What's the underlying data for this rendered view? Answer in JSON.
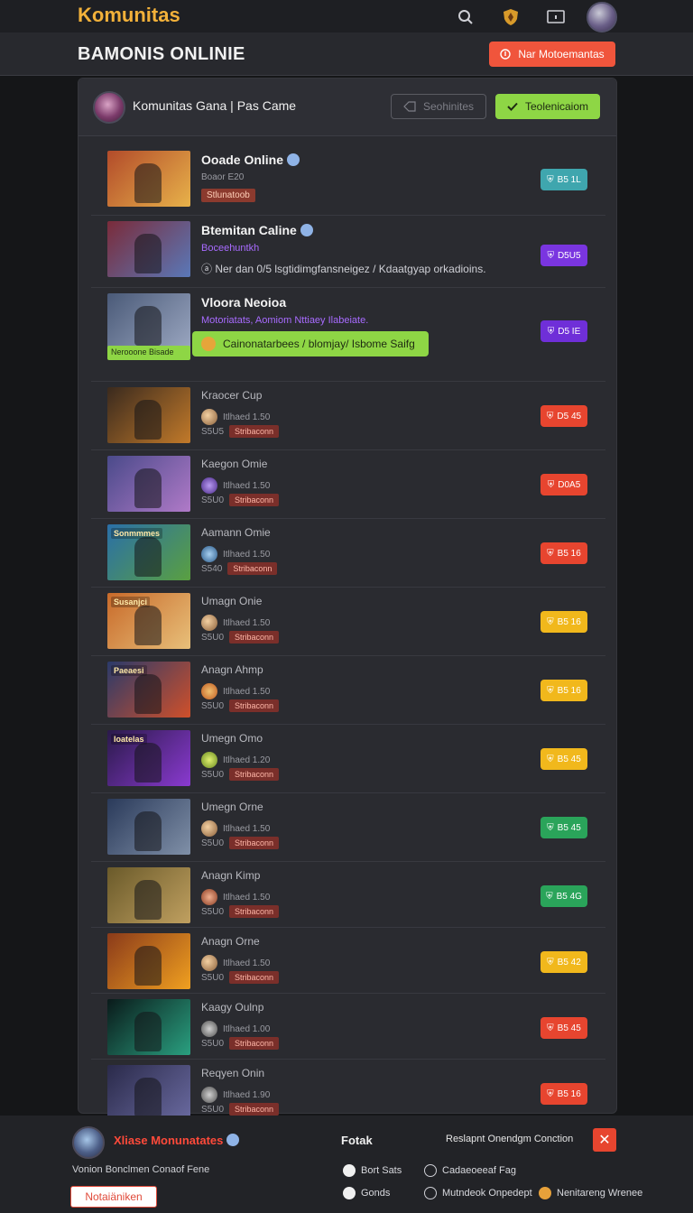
{
  "app": {
    "brand": "Komunitas"
  },
  "header": {
    "title": "BAMONIS ONLINIE",
    "cta_label": "Nar Motoemantas"
  },
  "panel": {
    "title": "Komunitas Gana | Pas Came",
    "outline_btn": "Seohinites",
    "green_btn": "Teolenicaiom"
  },
  "games": [
    {
      "title": "Ooade Online",
      "sub": "Boaor E20",
      "chip": "Stlunatoob",
      "badge": "B5 1L",
      "badge_color": "#3fa6ae",
      "thumb": [
        "#b24b2a",
        "#e8b24a"
      ]
    },
    {
      "title": "Btemitan Caline",
      "sub": "Boceehuntkh",
      "note": "Ner dan 0/5 lsgtidimgfansneigez / Kdaatgyap orkadioins.",
      "badge": "D5U5",
      "badge_color": "#7a35e0",
      "thumb": [
        "#7a2b3a",
        "#5a78b8"
      ]
    },
    {
      "title": "Vloora Neoioa",
      "sub": "Motoriatats, Aomiom Nttiaey Ilabeiate.",
      "promo": "Cainonatarbees / blomjay/ Isbome Saifg",
      "tag": "Nerooone Bisade",
      "badge": "D5 IE",
      "badge_color": "#6f2fd8",
      "thumb": [
        "#4a5a78",
        "#9aa6c0"
      ]
    },
    {
      "title": "Kraocer Cup",
      "meta": "Itlhaed 1.50",
      "num": "S5U5",
      "chip": "Stribaconn",
      "badge": "D5 45",
      "badge_color": "#e7452f",
      "thumb": [
        "#3a2a1e",
        "#c27a2a"
      ]
    },
    {
      "title": "Kaegon Omie",
      "meta": "Itlhaed 1.50",
      "num": "S5U0",
      "chip": "Stribaconn",
      "badge": "D0A5",
      "badge_color": "#e7452f",
      "thumb": [
        "#4a4a8a",
        "#b07ac8"
      ]
    },
    {
      "title": "Aamann Omie",
      "meta": "Itlhaed 1.50",
      "num": "S540",
      "chip": "Stribaconn",
      "badge": "B5 16",
      "badge_color": "#e7452f",
      "thumb": [
        "#2a6fa8",
        "#5aa040"
      ],
      "banner": "Sonmmmes"
    },
    {
      "title": "Umagn Onie",
      "meta": "Itlhaed 1.50",
      "num": "S5U0",
      "chip": "Stribaconn",
      "badge": "B5 16",
      "badge_color": "#f1b81c",
      "thumb": [
        "#c86a2a",
        "#e8c07a"
      ],
      "banner": "Susanjci"
    },
    {
      "title": "Anagn Ahmp",
      "meta": "Itlhaed 1.50",
      "num": "S5U0",
      "chip": "Stribaconn",
      "badge": "B5 16",
      "badge_color": "#f1b81c",
      "thumb": [
        "#2a3a6a",
        "#d0502a"
      ],
      "banner": "Paeaesi"
    },
    {
      "title": "Umegn Omo",
      "meta": "Itlhaed 1.20",
      "num": "S5U0",
      "chip": "Stribaconn",
      "badge": "B5 45",
      "badge_color": "#f1b81c",
      "thumb": [
        "#2a1a4a",
        "#8a3ad0"
      ],
      "banner": "Ioatelas"
    },
    {
      "title": "Umegn Orne",
      "meta": "Itlhaed 1.50",
      "num": "S5U0",
      "chip": "Stribaconn",
      "badge": "B5 45",
      "badge_color": "#2aa45a",
      "thumb": [
        "#2a3a5a",
        "#8090a8"
      ]
    },
    {
      "title": "Anagn Kimp",
      "meta": "Itlhaed 1.50",
      "num": "S5U0",
      "chip": "Stribaconn",
      "badge": "B5 4G",
      "badge_color": "#2aa45a",
      "thumb": [
        "#6a5a2a",
        "#c0a060"
      ]
    },
    {
      "title": "Anagn Orne",
      "meta": "Itlhaed 1.50",
      "num": "S5U0",
      "chip": "Stribaconn",
      "badge": "B5 42",
      "badge_color": "#f1b81c",
      "thumb": [
        "#8a3a1a",
        "#f0a020"
      ]
    },
    {
      "title": "Kaagy Oulnp",
      "meta": "Itlhaed 1.00",
      "num": "S5U0",
      "chip": "Stribaconn",
      "badge": "B5 45",
      "badge_color": "#e7452f",
      "thumb": [
        "#0a1a1a",
        "#2aa080"
      ]
    },
    {
      "title": "Reqyen Onin",
      "meta": "Itlhaed 1.90",
      "num": "S5U0",
      "chip": "Stribaconn",
      "badge": "B5 16",
      "badge_color": "#e7452f",
      "thumb": [
        "#2a2a4a",
        "#6a6aa0"
      ]
    }
  ],
  "footer": {
    "name": "Xliase Monunatates",
    "desc": "Vonion Bonclmen Conaof Fene",
    "button": "Notaiäniken",
    "col_title": "Fotak",
    "right_title": "Reslapnt Onendgm Conction",
    "links": [
      "Bort Sats",
      "Cadaeoeeaf Fag",
      "Gonds",
      "Mutndeok Onpedept",
      "Nenitareng Wrenee"
    ]
  }
}
